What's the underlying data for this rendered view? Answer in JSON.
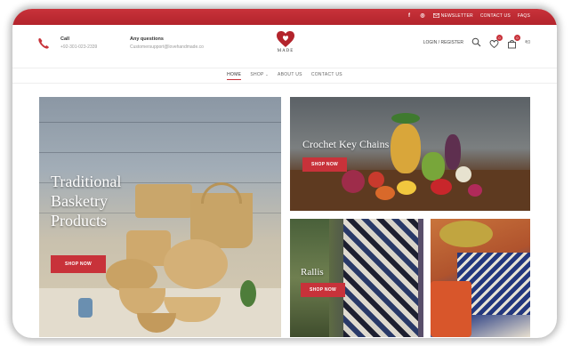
{
  "topbar": {
    "social": [
      "f",
      "◎"
    ],
    "newsletter": "NEWSLETTER",
    "contact_us": "CONTACT US",
    "faqs": "FAQS"
  },
  "header": {
    "call_label": "Call",
    "call_value": "+92-301-023-2339",
    "questions_label": "Any questions",
    "questions_value": "Customersupport@lovehandmade.co",
    "logo_text": "MADE",
    "login": "LOGIN / REGISTER",
    "wishlist_count": "0",
    "cart_count": "0",
    "cart_total": "₹0"
  },
  "nav": {
    "items": [
      "HOME",
      "SHOP",
      "ABOUT US",
      "CONTACT US"
    ]
  },
  "banners": {
    "basketry": {
      "title_lines": [
        "Traditional",
        "Basketry",
        "Products"
      ],
      "button": "SHOP NOW"
    },
    "crochet": {
      "title": "Crochet Key Chains",
      "button": "SHOP NOW"
    },
    "rallis": {
      "title": "Rallis",
      "button": "SHOP NOW"
    }
  },
  "icons": [
    "phone-icon",
    "facebook-icon",
    "instagram-icon",
    "mail-icon",
    "search-icon",
    "heart-icon",
    "bag-icon",
    "logo-heart-icon"
  ],
  "colors": {
    "accent": "#c8323a"
  }
}
